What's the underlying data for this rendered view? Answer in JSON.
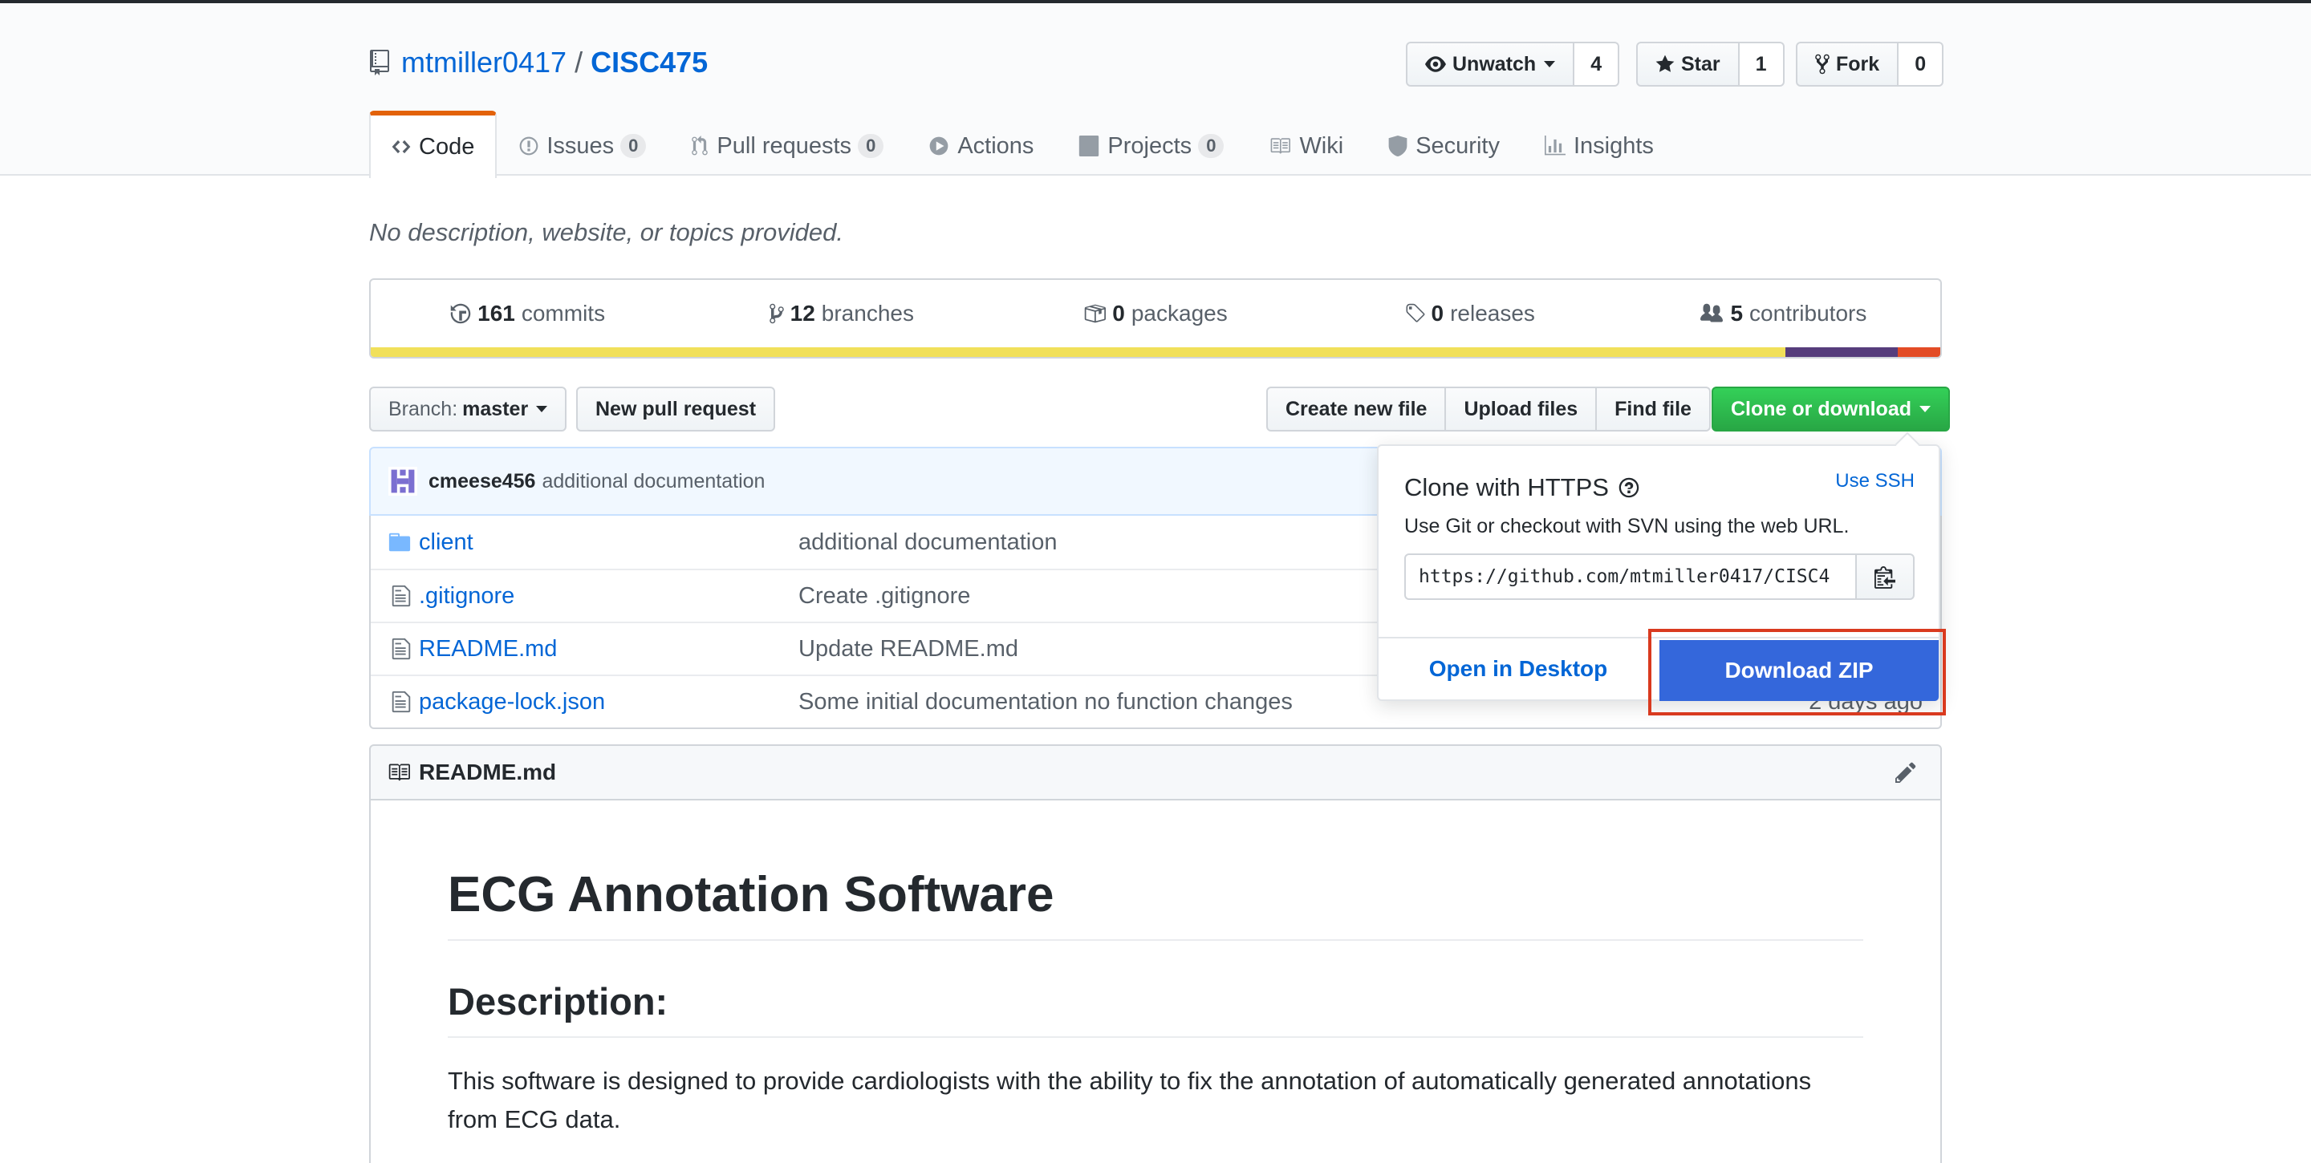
{
  "repo": {
    "owner": "mtmiller0417",
    "separator": "/",
    "name": "CISC475"
  },
  "actions": {
    "watch": {
      "label": "Unwatch",
      "count": "4"
    },
    "star": {
      "label": "Star",
      "count": "1"
    },
    "fork": {
      "label": "Fork",
      "count": "0"
    }
  },
  "nav": {
    "code": "Code",
    "issues": {
      "label": "Issues",
      "count": "0"
    },
    "pulls": {
      "label": "Pull requests",
      "count": "0"
    },
    "actions": "Actions",
    "projects": {
      "label": "Projects",
      "count": "0"
    },
    "wiki": "Wiki",
    "security": "Security",
    "insights": "Insights"
  },
  "description": "No description, website, or topics provided.",
  "summary": {
    "commits": {
      "count": "161",
      "label": "commits"
    },
    "branches": {
      "count": "12",
      "label": "branches"
    },
    "packages": {
      "count": "0",
      "label": "packages"
    },
    "releases": {
      "count": "0",
      "label": "releases"
    },
    "contributors": {
      "count": "5",
      "label": "contributors"
    }
  },
  "language_colors": [
    "#f1e05a",
    "#563d7c",
    "#e34c26"
  ],
  "toolbar": {
    "branch_prefix": "Branch:",
    "branch": "master",
    "new_pull_request": "New pull request",
    "create_new_file": "Create new file",
    "upload_files": "Upload files",
    "find_file": "Find file",
    "clone_or_download": "Clone or download"
  },
  "latest_commit": {
    "author": "cmeese456",
    "message": "additional documentation"
  },
  "files": [
    {
      "name": "client",
      "message": "additional documentation",
      "age": "",
      "type": "folder"
    },
    {
      "name": ".gitignore",
      "message": "Create .gitignore",
      "age": "",
      "type": "file"
    },
    {
      "name": "README.md",
      "message": "Update README.md",
      "age": "",
      "type": "file"
    },
    {
      "name": "package-lock.json",
      "message": "Some initial documentation no function changes",
      "age": "2 days ago",
      "type": "file"
    }
  ],
  "clone_dropdown": {
    "title": "Clone with HTTPS",
    "use_ssh": "Use SSH",
    "hint": "Use Git or checkout with SVN using the web URL.",
    "url": "https://github.com/mtmiller0417/CISC4",
    "open_desktop": "Open in Desktop",
    "download_zip": "Download ZIP"
  },
  "readme": {
    "filename": "README.md",
    "h1": "ECG Annotation Software",
    "h2": "Description:",
    "paragraph": "This software is designed to provide cardiologists with the ability to fix the annotation of automatically generated annotations from ECG data."
  }
}
